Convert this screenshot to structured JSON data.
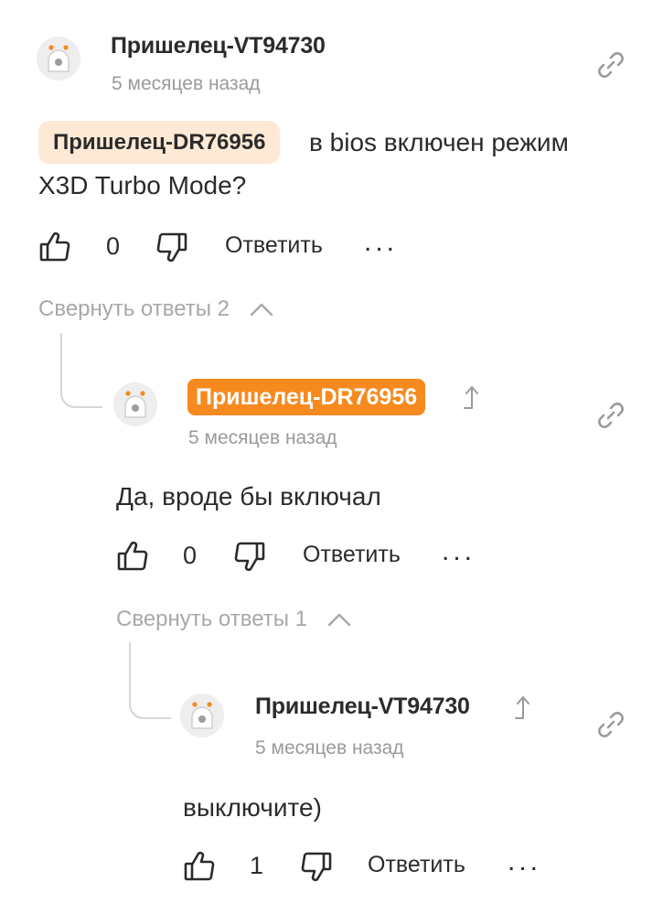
{
  "comments": [
    {
      "author": "Пришелец-VT94730",
      "time": "5 месяцев назад",
      "mention": "Пришелец-DR76956",
      "text_line1": "в bios включен режим",
      "text_line2": "X3D Turbo Mode?",
      "likes": "0",
      "reply_label": "Ответить",
      "more_label": "...",
      "collapse_label": "Свернуть ответы 2"
    },
    {
      "author": "Пришелец-DR76956",
      "time": "5 месяцев назад",
      "text": "Да, вроде бы включал",
      "likes": "0",
      "reply_label": "Ответить",
      "more_label": "...",
      "collapse_label": "Свернуть ответы 1"
    },
    {
      "author": "Пришелец-VT94730",
      "time": "5 месяцев назад",
      "text": "выключите)",
      "likes": "1",
      "reply_label": "Ответить",
      "more_label": "..."
    }
  ],
  "icons": {
    "avatar": "alien-avatar-icon",
    "like": "thumbs-up-icon",
    "dislike": "thumbs-down-icon",
    "link": "link-icon",
    "chevron": "chevron-up-icon",
    "jump": "jump-to-parent-icon"
  },
  "colors": {
    "accent": "#f68a1f",
    "mention_bg": "#fde9d6",
    "muted": "#9a9a9a"
  }
}
